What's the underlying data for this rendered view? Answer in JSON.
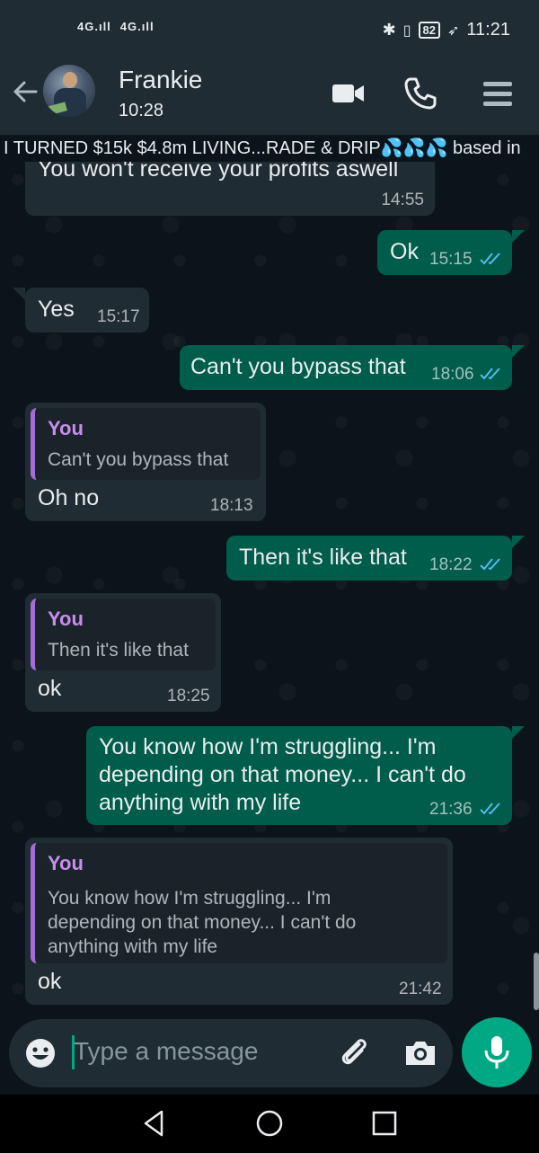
{
  "status_bar": {
    "signal_1": "4G.ıll",
    "signal_2": "4G.ıll",
    "battery": "82",
    "time": "11:21"
  },
  "header": {
    "contact_name": "Frankie",
    "subtitle": "10:28"
  },
  "marquee_text": "I TURNED $15k  $4.8m LIVING...RADE & DRIP💦💦💦 based in",
  "messages": [
    {
      "dir": "in",
      "text": "You won't receive your profits aswell",
      "time": "14:55"
    },
    {
      "dir": "out",
      "text": "Ok",
      "time": "15:15"
    },
    {
      "dir": "in",
      "text": "Yes",
      "time": "15:17"
    },
    {
      "dir": "out",
      "text": "Can't you bypass that",
      "time": "18:06"
    },
    {
      "dir": "in",
      "quote_author": "You",
      "quote_text": "Can't you bypass that",
      "text": "Oh no",
      "time": "18:13"
    },
    {
      "dir": "out",
      "text": "Then it's like that",
      "time": "18:22"
    },
    {
      "dir": "in",
      "quote_author": "You",
      "quote_text": "Then it's like that",
      "text": "ok",
      "time": "18:25"
    },
    {
      "dir": "out",
      "text": "You know how I'm struggling... I'm depending on that money... I can't do anything with my life",
      "time": "21:36"
    },
    {
      "dir": "in",
      "quote_author": "You",
      "quote_text": "You know how I'm struggling... I'm depending on that money... I can't do anything with my life",
      "text": "ok",
      "time": "21:42"
    }
  ],
  "input": {
    "placeholder": "Type a message"
  },
  "colors": {
    "accent": "#00a884",
    "outgoing_bubble": "#005c4b",
    "incoming_bubble": "#202c33",
    "quote_bar": "#a56bd6",
    "read_ticks": "#53bdeb"
  },
  "icons": [
    "back-arrow-icon",
    "video-call-icon",
    "phone-icon",
    "menu-icon",
    "emoji-icon",
    "attach-icon",
    "camera-icon",
    "mic-icon",
    "read-ticks-icon",
    "nav-back-icon",
    "nav-home-icon",
    "nav-recents-icon"
  ]
}
